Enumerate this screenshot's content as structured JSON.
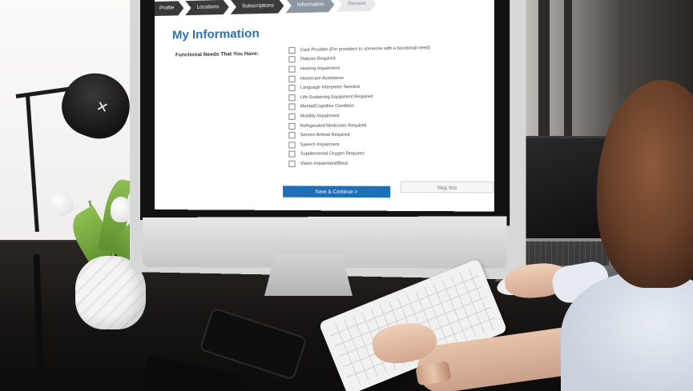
{
  "photo": {
    "subject": "woman using an iMac on a dark desk",
    "colors": {
      "accent_blue": "#2f70b0",
      "button_blue": "#1e6fb8",
      "step_dark": "#3a3a3a",
      "step_active": "#8d97a3",
      "desk": "#151311"
    }
  },
  "screen": {
    "steps": [
      {
        "label": "Profile",
        "state": "done"
      },
      {
        "label": "Locations",
        "state": "done"
      },
      {
        "label": "Subscriptions",
        "state": "done"
      },
      {
        "label": "Information",
        "state": "active"
      },
      {
        "label": "Review",
        "state": "todo"
      }
    ],
    "title": "My Information",
    "field_label": "Functional Needs That You Have:",
    "needs": [
      {
        "label": "Care Provider (For providers to someone with a functional need)",
        "checked": false
      },
      {
        "label": "Dialysis Required",
        "checked": false
      },
      {
        "label": "Hearing Impairment",
        "checked": false
      },
      {
        "label": "Homecare Assistance",
        "checked": false
      },
      {
        "label": "Language Interpreter Needed",
        "checked": false
      },
      {
        "label": "Life-Sustaining Equipment Required",
        "checked": false
      },
      {
        "label": "Mental/Cognitive Condition",
        "checked": false
      },
      {
        "label": "Mobility Impairment",
        "checked": false
      },
      {
        "label": "Refrigerated Medicines Required",
        "checked": false
      },
      {
        "label": "Service Animal Required",
        "checked": false
      },
      {
        "label": "Speech Impairment",
        "checked": false
      },
      {
        "label": "Supplemental Oxygen Required",
        "checked": false
      },
      {
        "label": "Vision Impairment/Blind",
        "checked": false
      }
    ],
    "save_button": "Save & Continue >",
    "skip_button": "Skip this"
  }
}
